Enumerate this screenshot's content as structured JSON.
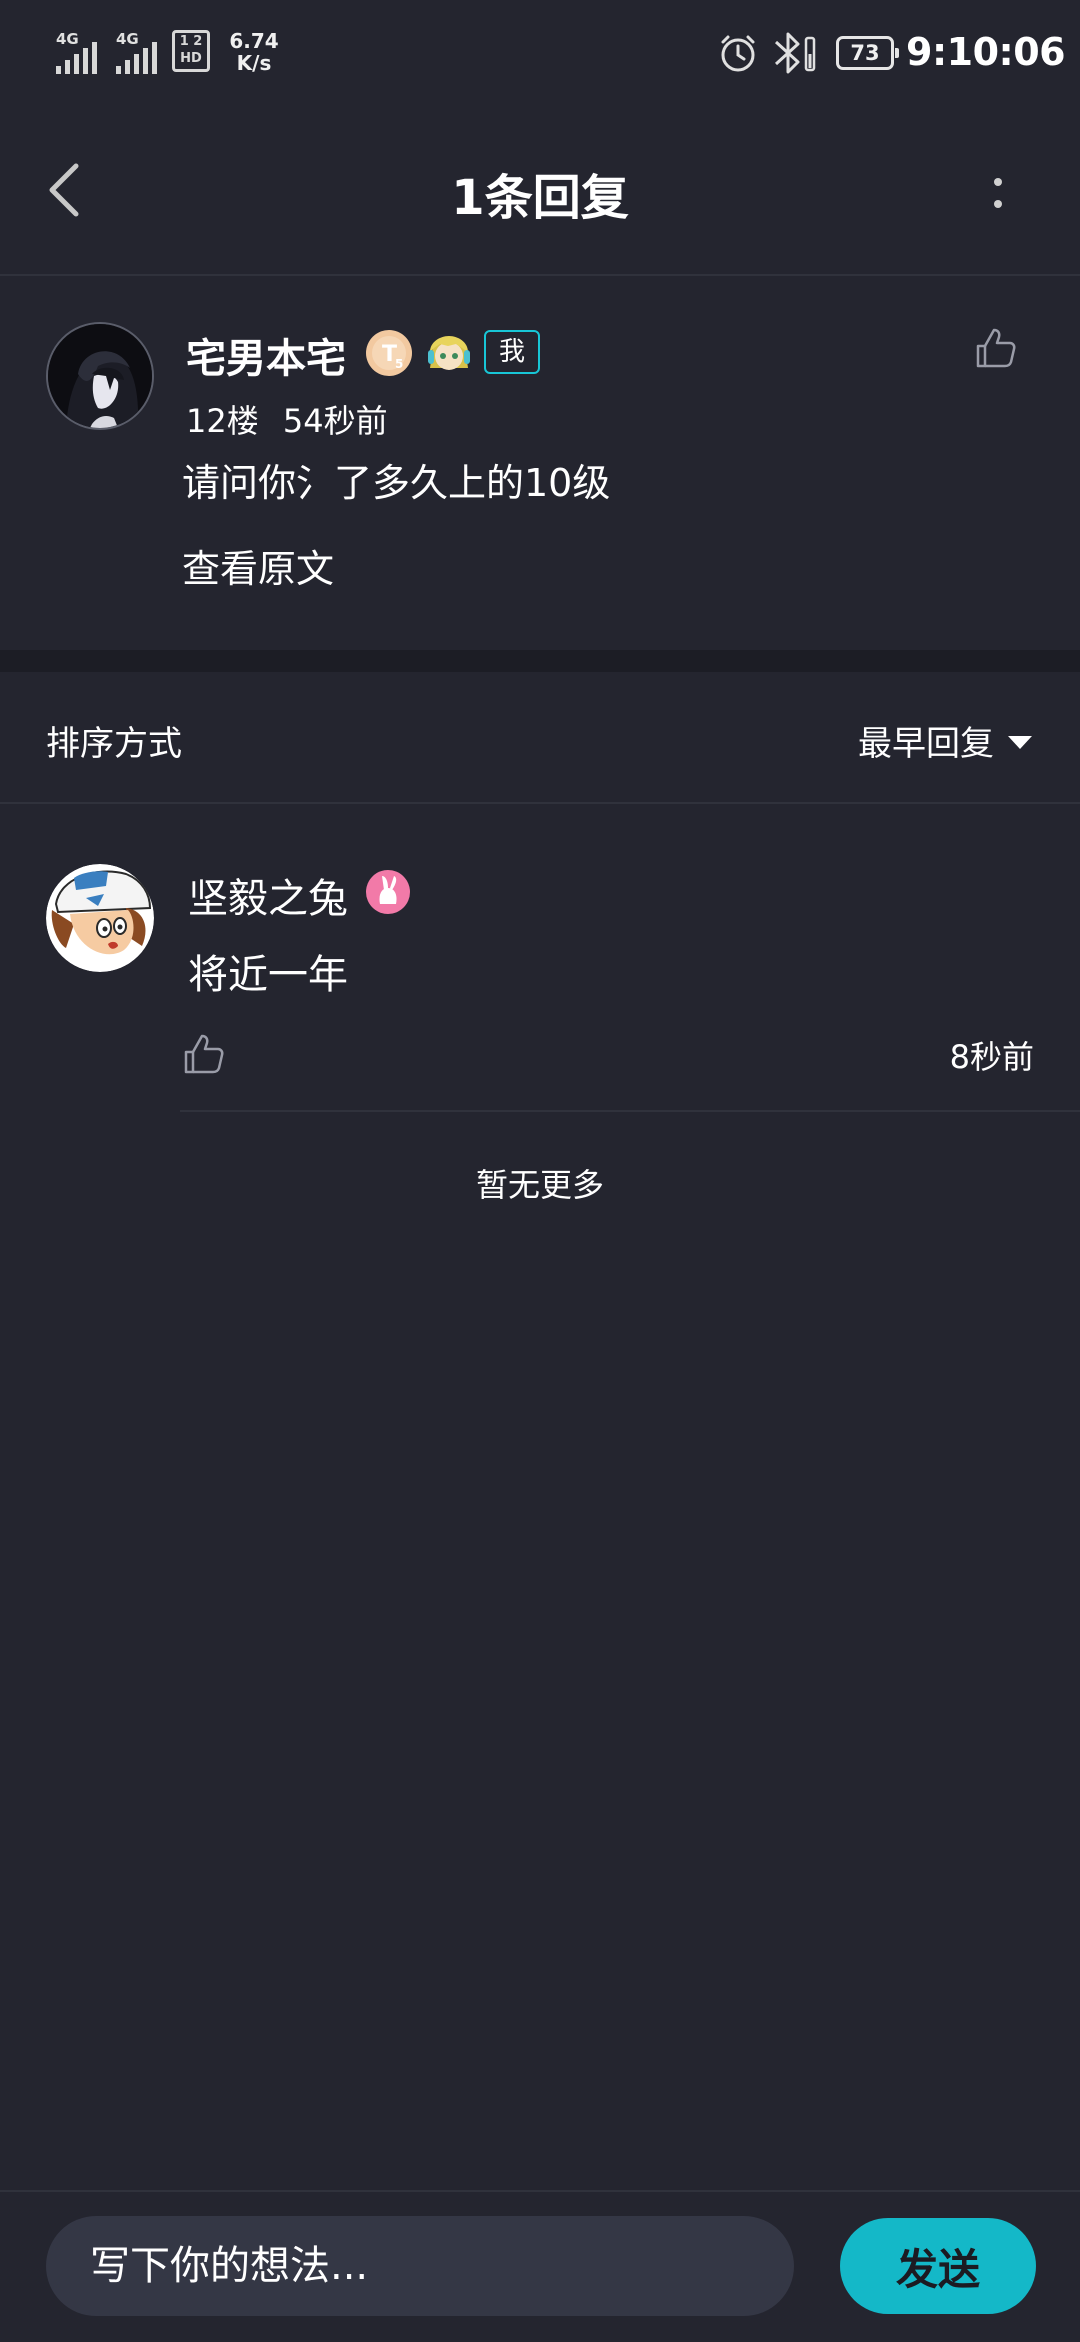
{
  "status_bar": {
    "signal1_label": "4G",
    "signal2_label": "4G",
    "hd_label": "1 2\nHD",
    "net_speed_value": "6.74",
    "net_speed_unit": "K/s",
    "battery_level": "73",
    "time": "9:10:06"
  },
  "header": {
    "title": "1条回复",
    "back_icon": "chevron-left-icon",
    "more_icon": "more-vertical-icon"
  },
  "post": {
    "author": "宅男本宅",
    "me_badge": "我",
    "floor": "12楼",
    "time": "54秒前",
    "text": "请问你氵了多久上的10级",
    "view_original": "查看原文"
  },
  "sort": {
    "label": "排序方式",
    "selected": "最早回复"
  },
  "replies": [
    {
      "author": "坚毅之兔",
      "text": "将近一年",
      "time": "8秒前"
    }
  ],
  "no_more": "暂无更多",
  "composer": {
    "placeholder": "写下你的想法...",
    "send_label": "发送"
  },
  "colors": {
    "background": "#24252f",
    "accent": "#14b8c8",
    "input_bg": "#343745"
  }
}
